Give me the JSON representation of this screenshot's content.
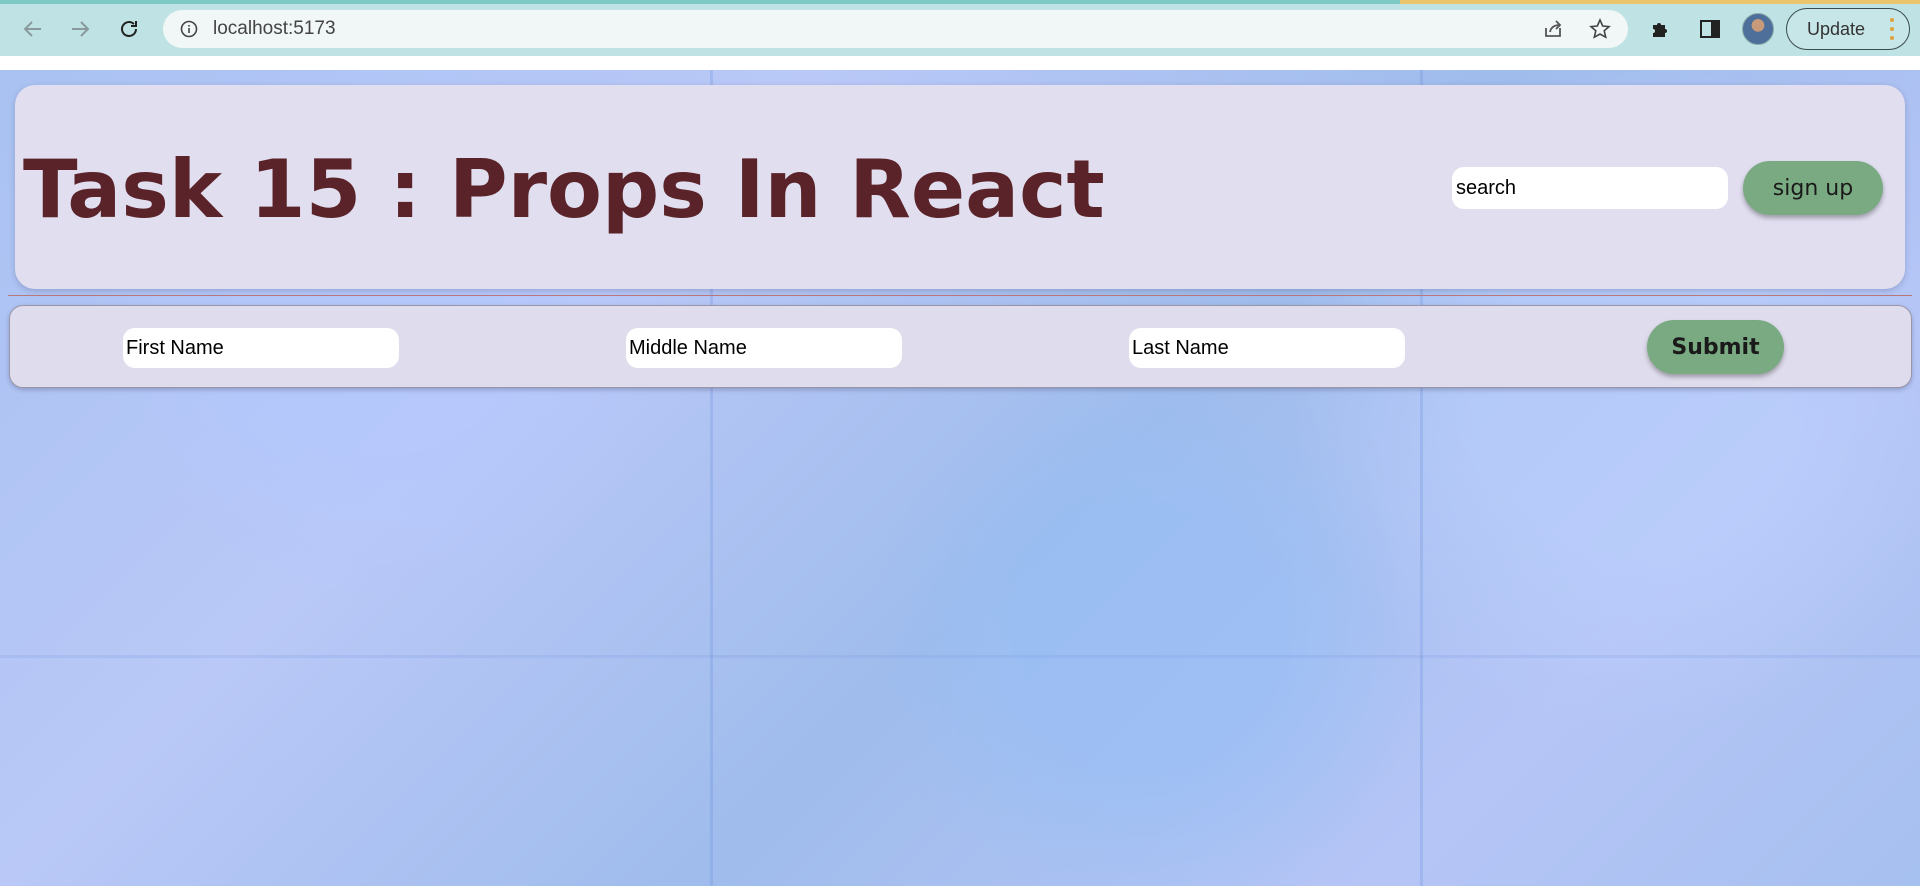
{
  "browser": {
    "url": "localhost:5173",
    "update_label": "Update",
    "icons": {
      "back": "arrow-left-icon",
      "forward": "arrow-right-icon",
      "reload": "reload-icon",
      "info": "info-icon",
      "share": "share-icon",
      "bookmark": "star-icon",
      "extensions": "puzzle-icon",
      "side_panel": "side-panel-icon",
      "profile": "avatar",
      "menu": "kebab-menu-icon"
    }
  },
  "header": {
    "title": "Task 15 : Props In React",
    "search_placeholder": "search",
    "signup_label": "sign up"
  },
  "form": {
    "first_name_placeholder": "First Name",
    "middle_name_placeholder": "Middle Name",
    "last_name_placeholder": "Last Name",
    "submit_label": "Submit"
  },
  "colors": {
    "title": "#5a2329",
    "button": "#7aaa82",
    "card": "#e0deef",
    "chrome": "#bfe2e4"
  }
}
